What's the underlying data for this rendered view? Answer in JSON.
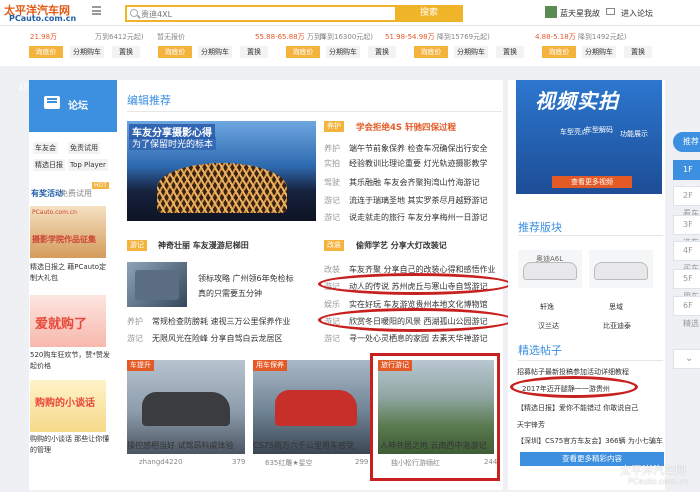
{
  "header": {
    "logo_cn": "太平洋汽车网",
    "logo_en": "PCauto.com.cn",
    "search_placeholder": "贵迪4XL",
    "search_button": "搜索",
    "username": "蓝天星我故",
    "forum_link": "进入论坛"
  },
  "price_strip": {
    "prices": [
      {
        "red": "21.98万",
        "gray": ""
      },
      {
        "red": "",
        "gray": "万到6412元起)"
      },
      {
        "red": "",
        "gray": "暂无报价"
      },
      {
        "red": "55.88-65.88万",
        "gray": "万到5"
      },
      {
        "red": "",
        "gray": "降到16300元起)"
      },
      {
        "red": "51.98-54.98万",
        "gray": "降到15769元起)"
      },
      {
        "red": "4.88-5.18万",
        "gray": "降到1492元起)"
      }
    ],
    "buttons": [
      "询底价",
      "分期购车",
      "置换"
    ]
  },
  "left": {
    "tab_label": "1F",
    "forum_title": "论坛",
    "chips": [
      "车友会",
      "免责试用",
      "精选日报",
      "Top Player"
    ],
    "activity": "有奖活动",
    "free_trial": "免费试用",
    "hot": "HOT",
    "thumb1_caption_lines": [
      "PCauto.com.cn",
      "摄影学院作品征集"
    ],
    "item1": "精选日报之 藉PCauto定制大礼包",
    "thumb2_text": "爱就购了",
    "item2": "520购车狂欢节，赞*赞发起价格",
    "thumb3_text": "购购的小谈话",
    "item3": "购购的小谈话 那些让你懂的管理"
  },
  "editor": {
    "title": "编辑推荐",
    "big_caption1": "车友分享摄影心得",
    "big_caption2": "为了保留时光的标本",
    "tag_top": "养护",
    "top_title": "学会拒绝4S 轩驰四保过程",
    "rows_top": [
      {
        "label": "养护",
        "text": "端午节前象保养 检查车况确保出行安全"
      },
      {
        "label": "实拍",
        "text": "经验教训比理论重要 灯光轨迹摄影教学"
      },
      {
        "label": "驾驶",
        "text": "其乐融融 车友会齐聚狗湾山竹海游记"
      },
      {
        "label": "游记",
        "text": "流连于瑞璃圣地 其实罗茶尽月越野游记"
      },
      {
        "label": "游记",
        "text": "说走就走的旅行 车友分享梅州一日游记"
      }
    ],
    "tag_mid_left": "游记",
    "mid_left_title": "神奇壮丽 车友漫游尼梯田",
    "tag_mid_right": "改装",
    "mid_right_title": "偷师学艺 分享大灯改装记",
    "car_text_lines": [
      "领标攻略 广州领6年免检标",
      "真的只需要五分钟"
    ],
    "rows_mid_right": [
      {
        "label": "改装",
        "text": "车友齐聚 分享自己的改装心得和感悟作业"
      },
      {
        "label": "游记",
        "text": "动人的传说 苏州虎丘与寒山寺自驾游记"
      },
      {
        "label": "娱乐",
        "text": "实在好玩 车友游览贵州本地文化博物馆"
      },
      {
        "label": "游记",
        "text": "欣赏冬日暖阳的风景 西湖孤山公园游记"
      },
      {
        "label": "游记",
        "text": "寻一处心灵栖息的家园 去素天华禅游记"
      }
    ],
    "rows_mid_left": [
      {
        "label": "养护",
        "text": "常规检查防膀耗 速视三万公里保养作业"
      },
      {
        "label": "游记",
        "text": "无限风光在险峰 分享自驾白云龙居区"
      }
    ]
  },
  "cards": [
    {
      "tag": "车提升",
      "caption": "操控感相当好 试驾昂科威体验",
      "meta": "zhangd4220",
      "count": "379"
    },
    {
      "tag": "用车保养",
      "caption": "CS75两万六千公里用车感受",
      "meta": "635红雕★星空",
      "count": "299"
    },
    {
      "tag": "旅行游记",
      "caption": "人神共居之地 云南西中洛游记",
      "meta": "独小松行游缅红",
      "count": "244"
    }
  ],
  "right": {
    "video_title": "视频实拍",
    "video_buttons": [
      "车型亮点",
      "车型解码",
      "功能展示"
    ],
    "video_more": "查看更多视频",
    "recommend_title": "推荐版块",
    "cars": [
      "轩逸",
      "思域",
      "汉兰达",
      "比亚迪泰"
    ],
    "car_top_labels": [
      "奥迪A6L",
      ""
    ],
    "posts_title": "精选帖子",
    "posts": [
      "招募帖子最新投稿参加活动详细教程",
      "2017年迈开腿静一一游贵州",
      "【精选日报】爱你不能错过 你敢说自己",
      "天宇锋芳",
      "【深圳】CS75官方车友会】366辆 为小七骗车"
    ],
    "more_posts": "查看更多精彩内容"
  },
  "side_nav": [
    "推荐",
    "1F 论坛",
    "2F 看车",
    "3F 选车",
    "4F 买车",
    "5F 用车",
    "6F 精选"
  ],
  "watermark": [
    "太平洋汽车网",
    "PCauto.com.cn"
  ]
}
